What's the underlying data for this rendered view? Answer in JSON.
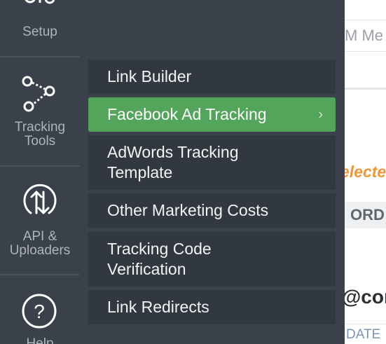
{
  "rail": {
    "items": [
      {
        "label": "Setup",
        "icon": "sliders-icon"
      },
      {
        "label": "Tracking Tools",
        "icon": "tracking-nodes-icon"
      },
      {
        "label": "API & Uploaders",
        "icon": "updown-arrows-icon"
      },
      {
        "label": "Help",
        "icon": "question-icon"
      }
    ]
  },
  "submenu": {
    "items": [
      {
        "label": "Link Builder"
      },
      {
        "label": "Facebook Ad Tracking",
        "chevron": "›"
      },
      {
        "label": "AdWords Tracking Template"
      },
      {
        "label": "Other Marketing Costs"
      },
      {
        "label": "Tracking Code Verification"
      },
      {
        "label": "Link Redirects"
      }
    ]
  },
  "background": {
    "input_fragment": "M Me",
    "selected_fragment": "electe",
    "ord_fragment": "ORD",
    "email_fragment": "@cor",
    "date_fragment": "DATE"
  },
  "colors": {
    "rail_bg": "#3a414b",
    "menu_item_bg": "#323840",
    "active_bg": "#52a55a",
    "accent_orange": "#f0963a"
  }
}
